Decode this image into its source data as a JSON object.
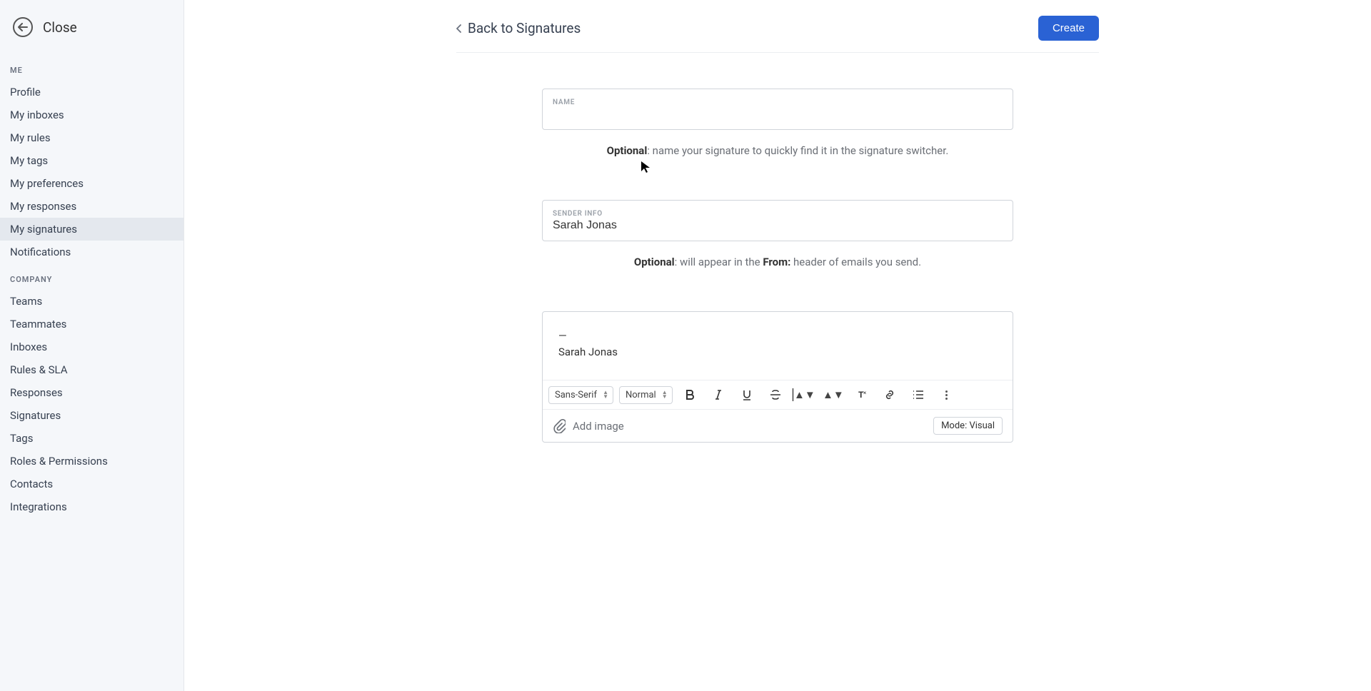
{
  "close_label": "Close",
  "sidebar": {
    "me_label": "ME",
    "company_label": "COMPANY",
    "me_items": [
      "Profile",
      "My inboxes",
      "My rules",
      "My tags",
      "My preferences",
      "My responses",
      "My signatures",
      "Notifications"
    ],
    "me_active_index": 6,
    "company_items": [
      "Teams",
      "Teammates",
      "Inboxes",
      "Rules & SLA",
      "Responses",
      "Signatures",
      "Tags",
      "Roles & Permissions",
      "Contacts",
      "Integrations"
    ]
  },
  "header": {
    "back_label": "Back to Signatures",
    "create_label": "Create"
  },
  "name_field": {
    "label": "NAME",
    "value": ""
  },
  "name_hint": {
    "strong": "Optional",
    "rest": ": name your signature to quickly find it in the signature switcher."
  },
  "sender_field": {
    "label": "SENDER INFO",
    "value": "Sarah Jonas"
  },
  "sender_hint": {
    "strong1": "Optional",
    "mid": ": will appear in the ",
    "strong2": "From:",
    "rest": " header of emails you send."
  },
  "editor": {
    "line1": "—",
    "line2": "Sarah Jonas",
    "font_select": "Sans-Serif",
    "size_select": "Normal",
    "add_image_label": "Add image",
    "mode_label": "Mode: Visual",
    "color_swatch": "#000000"
  }
}
